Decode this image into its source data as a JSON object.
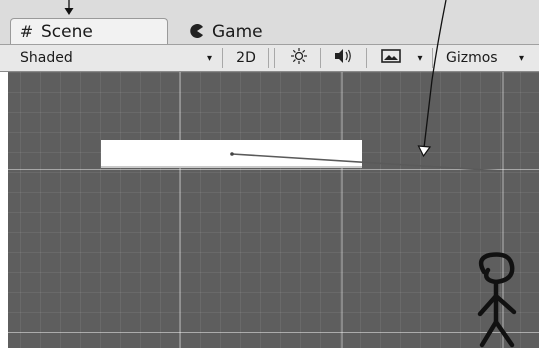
{
  "tabs": {
    "scene": {
      "icon": "grid-icon",
      "label": "Scene"
    },
    "game": {
      "icon": "pacman-icon",
      "label": "Game"
    }
  },
  "toolbar": {
    "draw_mode": "Shaded",
    "mode_2d": "2D",
    "lighting_icon": "sun-icon",
    "audio_icon": "speaker-icon",
    "effects_icon": "image-icon",
    "gizmos_label": "Gizmos"
  },
  "scene": {
    "background_color": "#5e5e5e",
    "platform_color": "#ffffff",
    "character": "stick-figure"
  },
  "annotations": {
    "arrow_color": "#111111"
  }
}
